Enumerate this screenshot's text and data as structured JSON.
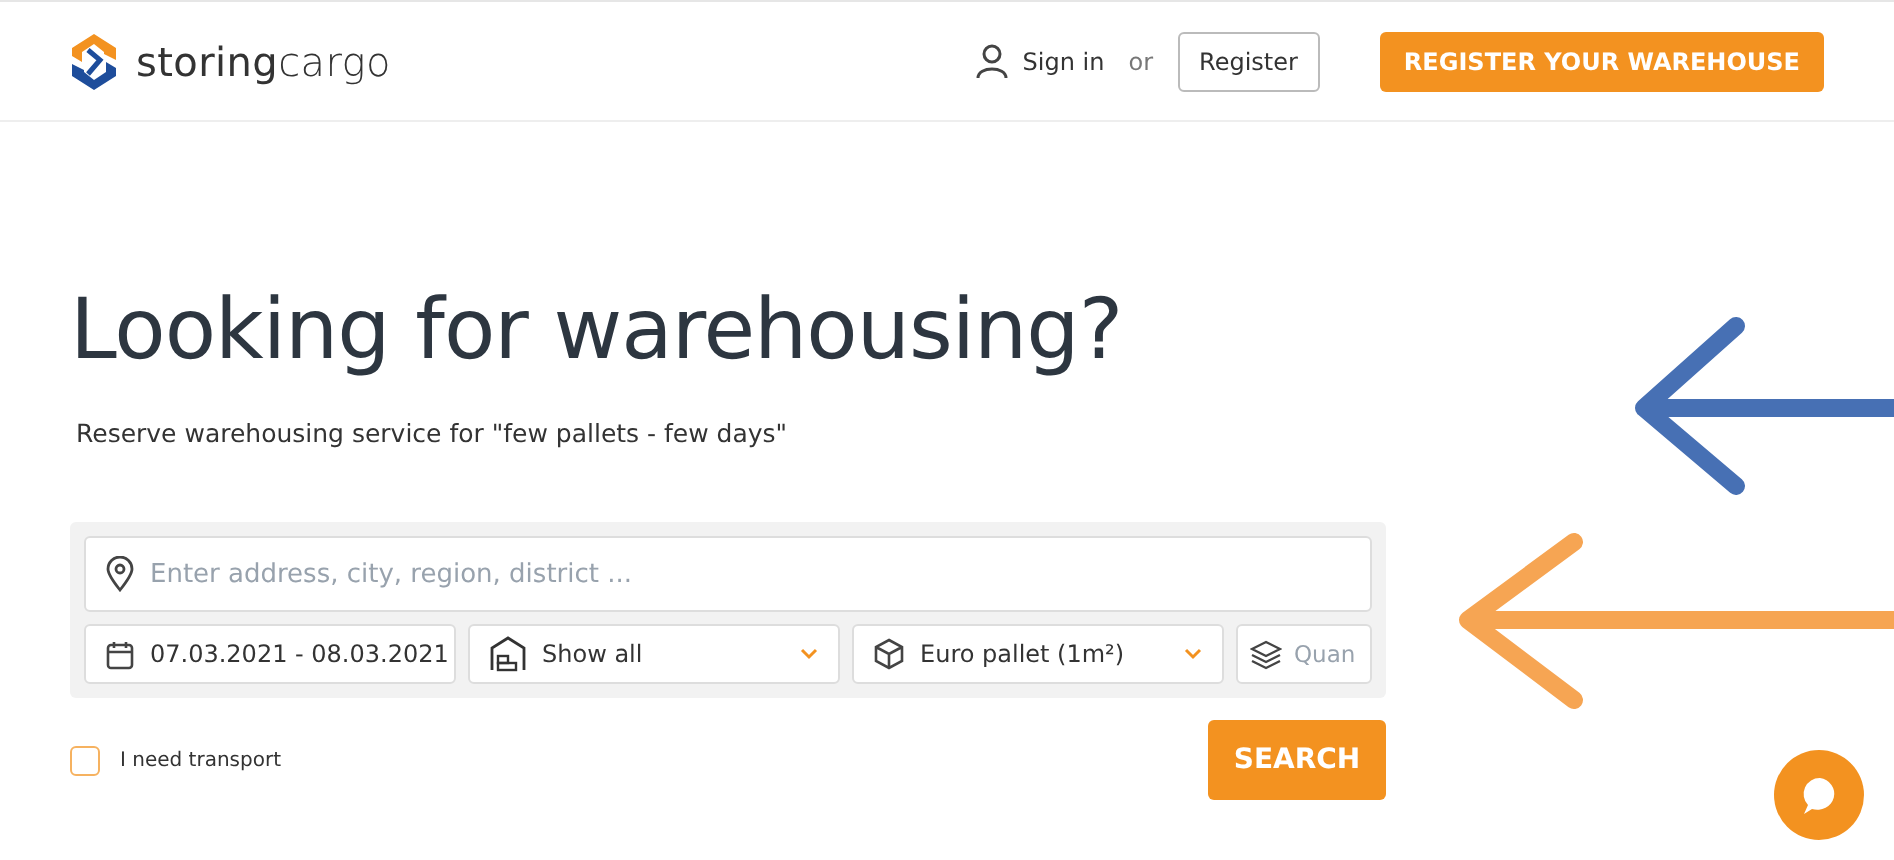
{
  "header": {
    "logo": "**storing**cargo",
    "sign_in": "Sign in",
    "or": "or",
    "register": "Register",
    "cta": "REGISTER YOUR WAREHOUSE"
  },
  "hero": {
    "title": "Looking for warehousing?",
    "subtitle": "Reserve warehousing service for \"few pallets - few days\""
  },
  "search": {
    "address_placeholder": "Enter address, city, region, district ...",
    "dates": "07.03.2021 - 08.03.2021",
    "type": "Show all",
    "unit": "Euro pallet (1m²)",
    "quantity_placeholder": "Quan"
  },
  "transport": {
    "label": "I need transport",
    "checked": false
  },
  "search_button": "SEARCH"
}
